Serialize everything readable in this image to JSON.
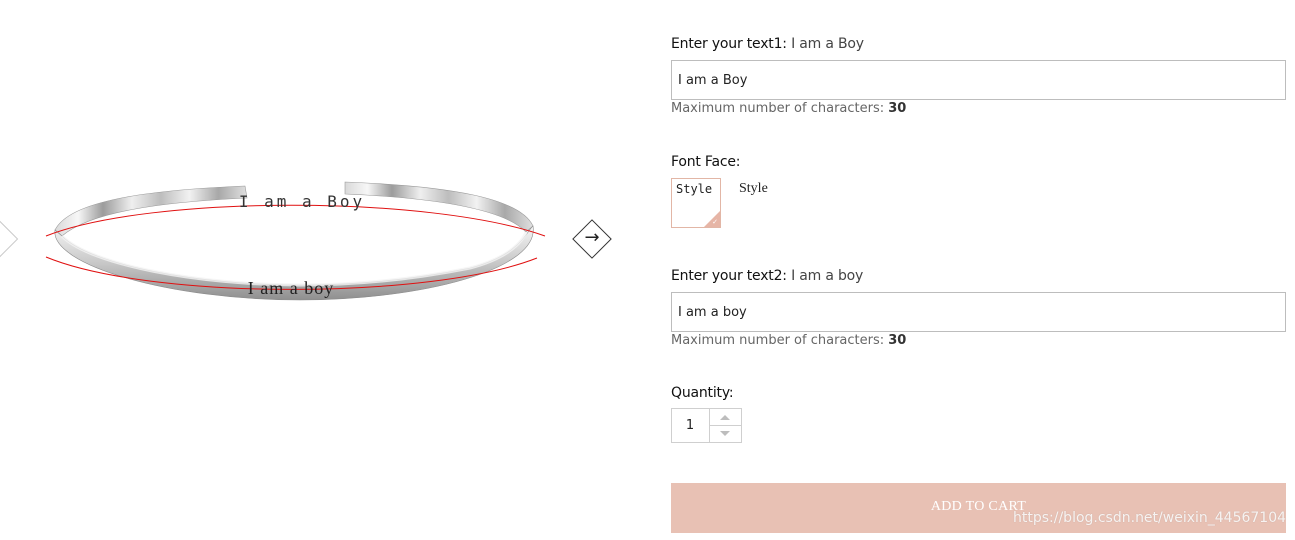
{
  "gallery": {
    "engraving_top": "I am a Boy",
    "engraving_bottom": "I am a boy",
    "prev_icon": "chevron-left-icon",
    "next_icon": "arrow-right-icon"
  },
  "text1": {
    "label": "Enter your text1:",
    "value_display": "I am a Boy",
    "input_value": "I am a Boy",
    "hint": "Maximum number of characters:",
    "max": "30"
  },
  "font_face": {
    "label": "Font Face:",
    "swatch_text": "Style",
    "selected_name": "Style",
    "selected_icon": "checkmark-icon"
  },
  "text2": {
    "label": "Enter your text2:",
    "value_display": "I am a boy",
    "input_value": "I am a boy",
    "hint": "Maximum number of characters:",
    "max": "30"
  },
  "quantity": {
    "label": "Quantity:",
    "value": "1",
    "up_icon": "caret-up-icon",
    "down_icon": "caret-down-icon"
  },
  "cart": {
    "button_label": "ADD TO CART",
    "color": "#e8c1b4"
  },
  "watermark": "https://blog.csdn.net/weixin_44567104"
}
